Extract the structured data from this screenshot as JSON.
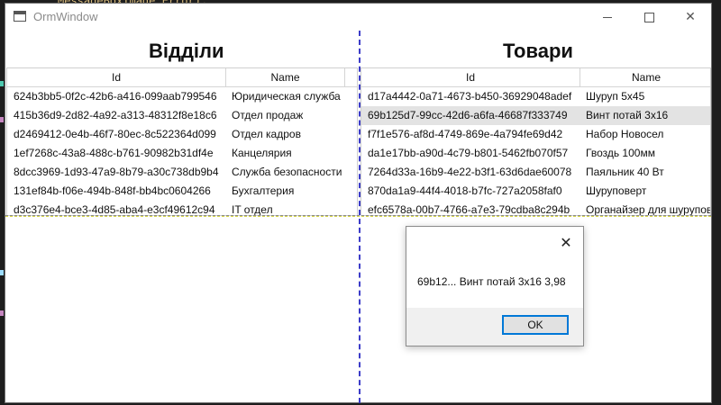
{
  "background": {
    "code_snippet": "MessageBoxImage.Error);"
  },
  "window": {
    "title": "OrmWindow",
    "controls": {
      "minimize": "–",
      "maximize": "□",
      "close": "✕"
    }
  },
  "departments": {
    "title": "Відділи",
    "columns": [
      "Id",
      "Name"
    ],
    "rows": [
      {
        "id": "624b3bb5-0f2c-42b6-a416-099aab799546",
        "name": "Юридическая служба"
      },
      {
        "id": "415b36d9-2d82-4a92-a313-48312f8e18c6",
        "name": "Отдел продаж"
      },
      {
        "id": "d2469412-0e4b-46f7-80ec-8c522364d099",
        "name": "Отдел кадров"
      },
      {
        "id": "1ef7268c-43a8-488c-b761-90982b31df4e",
        "name": "Канцелярия"
      },
      {
        "id": "8dcc3969-1d93-47a9-8b79-a30c738db9b4",
        "name": "Служба безопасности"
      },
      {
        "id": "131ef84b-f06e-494b-848f-bb4bc0604266",
        "name": "Бухгалтерия"
      },
      {
        "id": "d3c376e4-bce3-4d85-aba4-e3cf49612c94",
        "name": "IT отдел"
      }
    ]
  },
  "products": {
    "title": "Товари",
    "columns": [
      "Id",
      "Name"
    ],
    "rows": [
      {
        "id": "d17a4442-0a71-4673-b450-36929048adef",
        "name": "Шуруп 5x45"
      },
      {
        "id": "69b125d7-99cc-42d6-a6fa-46687f333749",
        "name": "Винт потай 3x16"
      },
      {
        "id": "f7f1e576-af8d-4749-869e-4a794fe69d42",
        "name": "Набор Новосел"
      },
      {
        "id": "da1e17bb-a90d-4c79-b801-5462fb070f57",
        "name": "Гвоздь 100мм"
      },
      {
        "id": "7264d33a-16b9-4e22-b3f1-63d6dae60078",
        "name": "Паяльник 40 Вт"
      },
      {
        "id": "870da1a9-44f4-4018-b7fc-727a2058faf0",
        "name": "Шуруповерт"
      },
      {
        "id": "efc6578a-00b7-4766-a7e3-79cdba8c294b",
        "name": "Органайзер для шурупов"
      }
    ],
    "selected_index": 1
  },
  "dialog": {
    "message": "69b12... Винт потай 3x16 3,98",
    "ok_label": "OK",
    "close_glyph": "✕"
  }
}
